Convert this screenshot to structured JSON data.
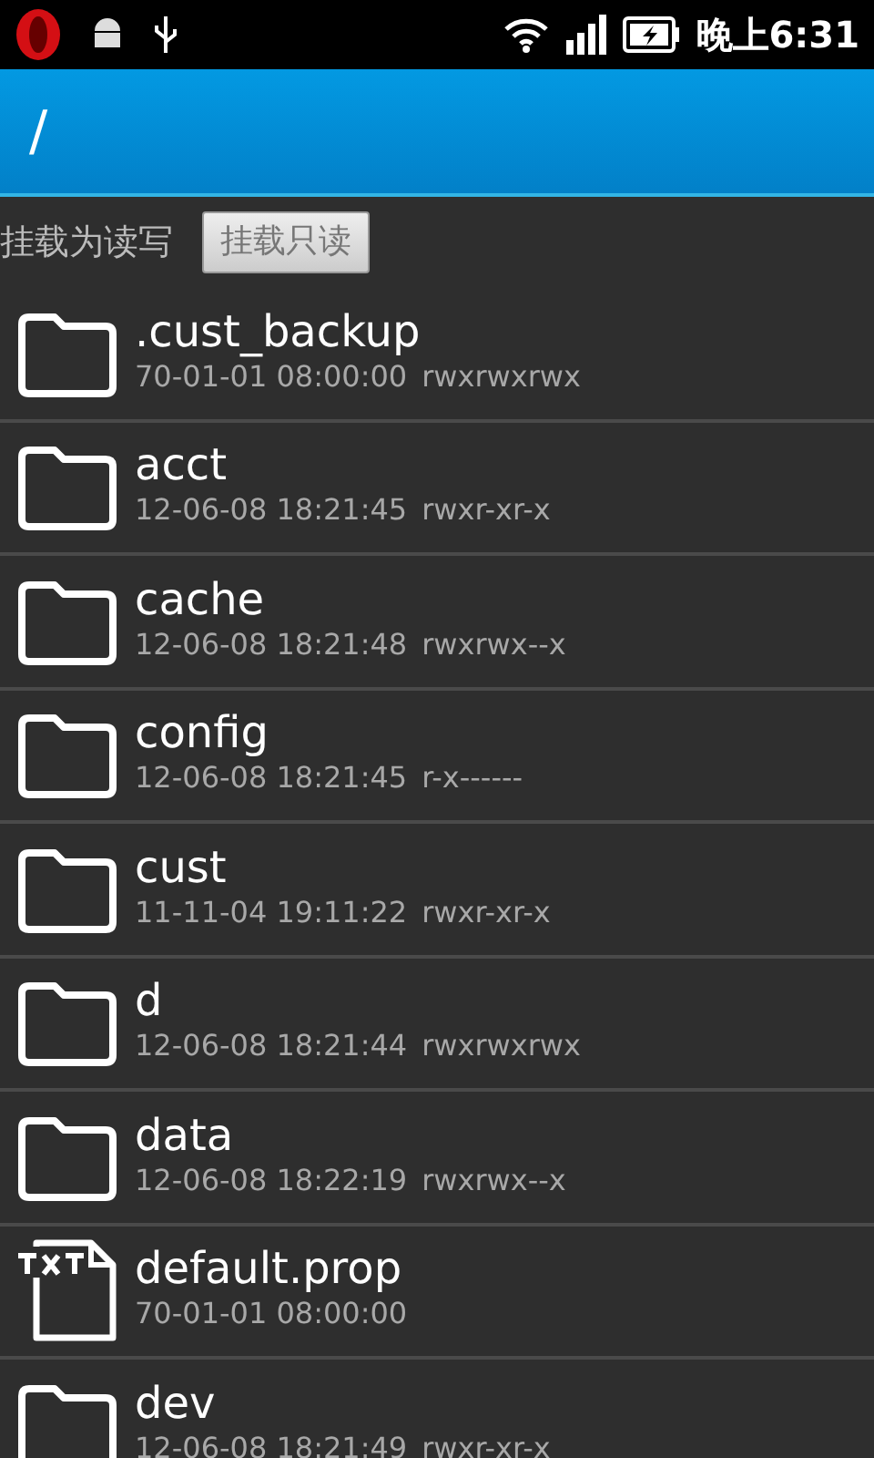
{
  "status_bar": {
    "time": "晚上6:31"
  },
  "title_bar": {
    "path": "/"
  },
  "toolbar": {
    "label": "挂载为读写",
    "button": "挂载只读"
  },
  "files": [
    {
      "kind": "folder",
      "name": ".cust_backup",
      "date": "70-01-01 08:00:00",
      "permissions": "rwxrwxrwx"
    },
    {
      "kind": "folder",
      "name": "acct",
      "date": "12-06-08 18:21:45",
      "permissions": "rwxr-xr-x"
    },
    {
      "kind": "folder",
      "name": "cache",
      "date": "12-06-08 18:21:48",
      "permissions": "rwxrwx--x"
    },
    {
      "kind": "folder",
      "name": "config",
      "date": "12-06-08 18:21:45",
      "permissions": "r-x------"
    },
    {
      "kind": "folder",
      "name": "cust",
      "date": "11-11-04 19:11:22",
      "permissions": "rwxr-xr-x"
    },
    {
      "kind": "folder",
      "name": "d",
      "date": "12-06-08 18:21:44",
      "permissions": "rwxrwxrwx"
    },
    {
      "kind": "folder",
      "name": "data",
      "date": "12-06-08 18:22:19",
      "permissions": "rwxrwx--x"
    },
    {
      "kind": "text",
      "name": "default.prop",
      "date": "70-01-01 08:00:00"
    },
    {
      "kind": "folder",
      "name": "dev",
      "date": "12-06-08 18:21:49",
      "permissions": "rwxr-xr-x"
    }
  ]
}
